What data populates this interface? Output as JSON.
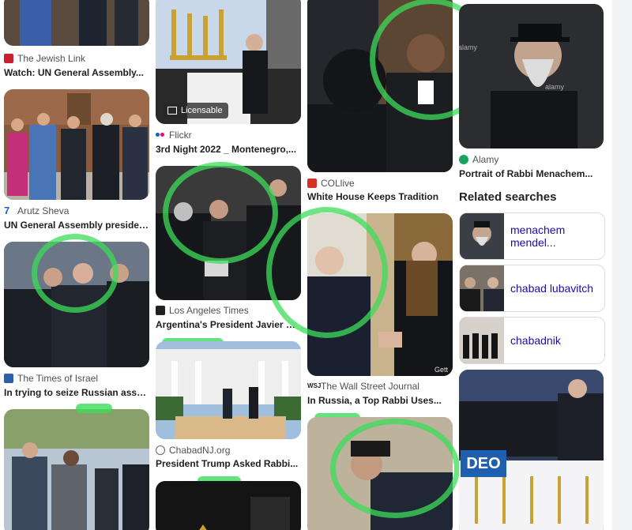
{
  "results": [
    {
      "source": "The Jewish Link",
      "title": "Watch: UN General Assembly..."
    },
    {
      "source": "Arutz Sheva",
      "title": "UN General Assembly president..."
    },
    {
      "source": "The Times of Israel",
      "title": "In trying to seize Russian assets..."
    },
    {
      "source": "Flickr",
      "title": "3rd Night 2022 _ Montenegro,..."
    },
    {
      "source": "Los Angeles Times",
      "title": "Argentina's President Javier Mil..."
    },
    {
      "source": "ChabadNJ.org",
      "title": "President Trump Asked Rabbi..."
    },
    {
      "source": "COLlive",
      "title": "White House Keeps Tradition"
    },
    {
      "source": "The Wall Street Journal",
      "title": "In Russia, a Top Rabbi Uses..."
    },
    {
      "source": "Alamy",
      "title": "Portrait of Rabbi Menachem..."
    }
  ],
  "badge": {
    "licensable": "Licensable"
  },
  "overlay_text": {
    "alamy1": "alamy",
    "alamy2": "alamy",
    "getty": "Gett",
    "deo": "DEO"
  },
  "related": {
    "heading": "Related searches",
    "items": [
      {
        "label": "menachem mendel..."
      },
      {
        "label": "chabad lubavitch"
      },
      {
        "label": "chabadnik"
      }
    ]
  },
  "colors": {
    "highlight": "#3cdc5a",
    "link": "#1a0dab"
  }
}
